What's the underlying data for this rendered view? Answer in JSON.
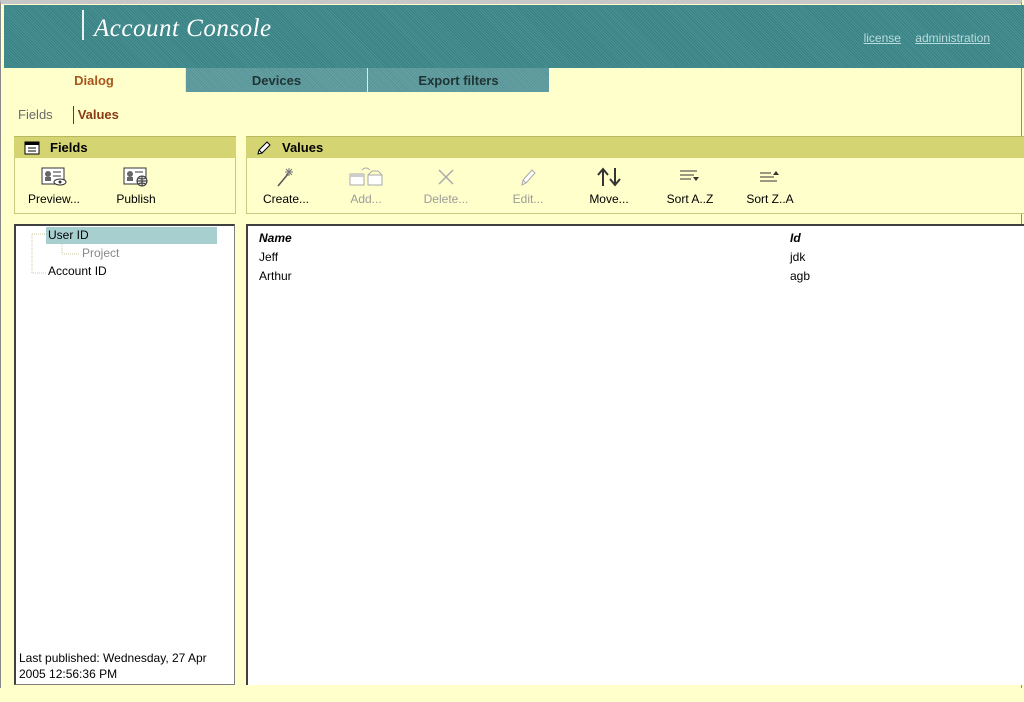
{
  "header": {
    "title": "Account Console",
    "links": [
      {
        "label": "license"
      },
      {
        "label": "administration"
      }
    ]
  },
  "tabs": [
    {
      "label": "Dialog",
      "active": true
    },
    {
      "label": "Devices",
      "active": false
    },
    {
      "label": "Export filters",
      "active": false
    }
  ],
  "subnav": {
    "fields": "Fields",
    "values": "Values"
  },
  "fields_panel": {
    "title": "Fields",
    "buttons": [
      {
        "label": "Preview...",
        "icon": "preview-icon"
      },
      {
        "label": "Publish",
        "icon": "publish-icon"
      }
    ]
  },
  "values_panel": {
    "title": "Values",
    "buttons": [
      {
        "label": "Create...",
        "icon": "create-icon",
        "enabled": true
      },
      {
        "label": "Add...",
        "icon": "add-icon",
        "enabled": false
      },
      {
        "label": "Delete...",
        "icon": "delete-icon",
        "enabled": false
      },
      {
        "label": "Edit...",
        "icon": "edit-icon",
        "enabled": false
      },
      {
        "label": "Move...",
        "icon": "move-icon",
        "enabled": true
      },
      {
        "label": "Sort A..Z",
        "icon": "sort-az-icon",
        "enabled": true
      },
      {
        "label": "Sort Z..A",
        "icon": "sort-za-icon",
        "enabled": true
      }
    ]
  },
  "tree": {
    "nodes": [
      {
        "label": "User ID",
        "selected": true
      },
      {
        "label": "Project",
        "selected": false
      },
      {
        "label": "Account ID",
        "selected": false
      }
    ],
    "status": "Last published: Wednesday, 27 Apr 2005 12:56:36 PM"
  },
  "table": {
    "columns": [
      "Name",
      "Id"
    ],
    "rows": [
      {
        "name": "Jeff",
        "id": "jdk"
      },
      {
        "name": "Arthur",
        "id": "agb"
      }
    ]
  },
  "colors": {
    "header_teal": "#3f8d90",
    "background": "#ffffcc",
    "panel_header": "#d4d473",
    "active_tab_text": "#a8551e",
    "selection": "#a8cfd0"
  }
}
